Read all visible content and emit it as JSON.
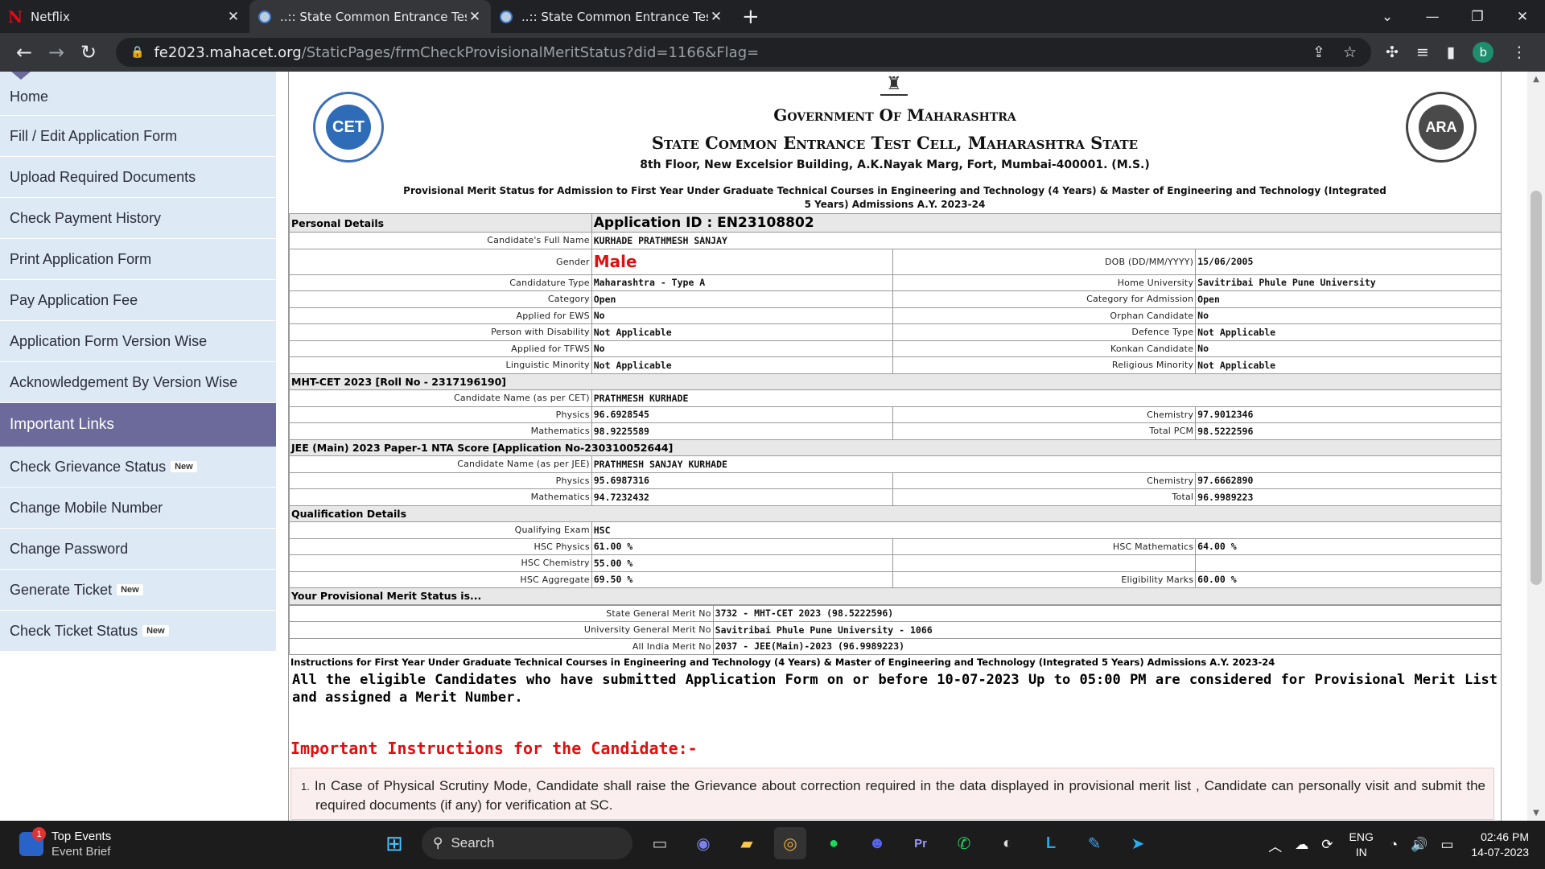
{
  "browser": {
    "tabs": [
      {
        "title": "Netflix",
        "icon": "netflix-icon"
      },
      {
        "title": "..:: State Common Entrance Test C",
        "icon": "cet-icon",
        "active": true
      },
      {
        "title": "..:: State Common Entrance Test C",
        "icon": "cet-icon"
      }
    ],
    "url_host": "fe2023.mahacet.org",
    "url_path": "/StaticPages/frmCheckProvisionalMeritStatus?did=1166&Flag=",
    "profile_initial": "b"
  },
  "sidebar": {
    "items": [
      {
        "label": "Home"
      },
      {
        "label": "Fill / Edit Application Form"
      },
      {
        "label": "Upload Required Documents"
      },
      {
        "label": "Check Payment History"
      },
      {
        "label": "Print Application Form"
      },
      {
        "label": "Pay Application Fee"
      },
      {
        "label": "Application Form Version Wise"
      },
      {
        "label": "Acknowledgement By Version Wise"
      }
    ],
    "section_heading": "Important Links",
    "links": [
      {
        "label": "Check Grievance Status",
        "badge": "New"
      },
      {
        "label": "Change Mobile Number",
        "badge": ""
      },
      {
        "label": "Change Password",
        "badge": ""
      },
      {
        "label": "Generate Ticket",
        "badge": "New"
      },
      {
        "label": "Check Ticket Status",
        "badge": "New"
      }
    ]
  },
  "header": {
    "left_logo": "CET",
    "right_logo": "ARA",
    "line1": "Government Of Maharashtra",
    "line2": "State Common Entrance Test Cell, Maharashtra State",
    "address": "8th Floor, New Excelsior Building, A.K.Nayak Marg, Fort, Mumbai-400001. (M.S.)",
    "subtitle": "Provisional Merit Status for Admission to First Year Under Graduate Technical Courses in Engineering and Technology (4 Years) & Master of Engineering and Technology (Integrated 5 Years) Admissions A.Y. 2023-24"
  },
  "personal": {
    "section": "Personal Details",
    "application_id": "Application ID : EN23108802",
    "full_name_label": "Candidate's Full Name",
    "full_name": "KURHADE PRATHMESH SANJAY",
    "gender_label": "Gender",
    "gender": "Male",
    "dob_label": "DOB (DD/MM/YYYY)",
    "dob": "15/06/2005",
    "rows": [
      {
        "l1": "Candidature Type",
        "v1": "Maharashtra - Type A",
        "l2": "Home University",
        "v2": "Savitribai Phule Pune University"
      },
      {
        "l1": "Category",
        "v1": "Open",
        "l2": "Category for Admission",
        "v2": "Open"
      },
      {
        "l1": "Applied for EWS",
        "v1": "No",
        "l2": "Orphan Candidate",
        "v2": "No"
      },
      {
        "l1": "Person with Disability",
        "v1": "Not Applicable",
        "l2": "Defence Type",
        "v2": "Not Applicable"
      },
      {
        "l1": "Applied for TFWS",
        "v1": "No",
        "l2": "Konkan Candidate",
        "v2": "No"
      },
      {
        "l1": "Linguistic Minority",
        "v1": "Not Applicable",
        "l2": "Religious Minority",
        "v2": "Not Applicable"
      }
    ]
  },
  "cet": {
    "section": "MHT-CET 2023 [Roll No - 2317196190]",
    "name_label": "Candidate Name (as per CET)",
    "name": "PRATHMESH KURHADE",
    "rows": [
      {
        "l1": "Physics",
        "v1": "96.6928545",
        "l2": "Chemistry",
        "v2": "97.9012346"
      },
      {
        "l1": "Mathematics",
        "v1": "98.9225589",
        "l2": "Total PCM",
        "v2": "98.5222596"
      }
    ]
  },
  "jee": {
    "section": "JEE (Main) 2023 Paper-1 NTA Score [Application No-230310052644]",
    "name_label": "Candidate Name (as per JEE)",
    "name": "PRATHMESH SANJAY KURHADE",
    "rows": [
      {
        "l1": "Physics",
        "v1": "95.6987316",
        "l2": "Chemistry",
        "v2": "97.6662890"
      },
      {
        "l1": "Mathematics",
        "v1": "94.7232432",
        "l2": "Total",
        "v2": "96.9989223"
      }
    ]
  },
  "qualification": {
    "section": "Qualification Details",
    "exam_label": "Qualifying Exam",
    "exam": "HSC",
    "rows": [
      {
        "l1": "HSC Physics",
        "v1": "61.00 %",
        "l2": "HSC Mathematics",
        "v2": "64.00 %"
      },
      {
        "l1": "HSC Chemistry",
        "v1": "55.00 %",
        "l2": "",
        "v2": ""
      },
      {
        "l1": "HSC Aggregate",
        "v1": "69.50 %",
        "l2": "Eligibility Marks",
        "v2": "60.00 %"
      }
    ]
  },
  "merit": {
    "section": "Your Provisional Merit Status is...",
    "rows": [
      {
        "label": "State General Merit No",
        "value": "3732 - MHT-CET 2023 (98.5222596)"
      },
      {
        "label": "University General Merit No",
        "value": "Savitribai Phule Pune University - 1066"
      },
      {
        "label": "All India Merit No",
        "value": "2037 - JEE(Main)-2023 (96.9989223)"
      }
    ]
  },
  "instructions": {
    "heading": "Instructions for First Year Under Graduate Technical Courses in Engineering and Technology (4 Years) & Master of Engineering and Technology (Integrated 5 Years) Admissions A.Y. 2023-24",
    "note": "All the eligible Candidates who have submitted Application Form on or before 10-07-2023 Up to 05:00 PM are considered for Provisional Merit List and assigned a Merit Number.",
    "important_title": "Important Instructions for the Candidate:-",
    "item1_number": "1.",
    "item1": "In Case of Physical Scrutiny Mode, Candidate shall raise the Grievance about correction required in the data displayed in provisional merit list , Candidate can personally visit and submit the required documents (if any) for verification at SC."
  },
  "taskbar": {
    "weather_badge": "1",
    "weather_title": "Top Events",
    "weather_sub": "Event Brief",
    "search": "Search",
    "lang1": "ENG",
    "lang2": "IN",
    "time": "02:46 PM",
    "date": "14-07-2023"
  }
}
